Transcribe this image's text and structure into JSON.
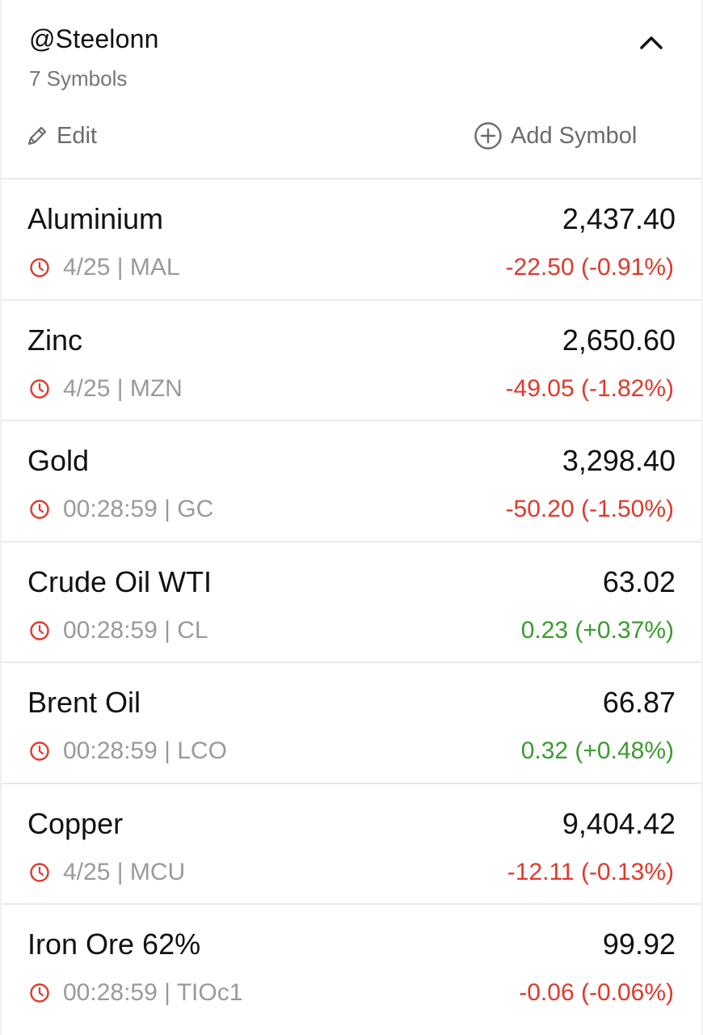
{
  "watchlist": {
    "title": "@Steelonn",
    "count_label": "7 Symbols",
    "edit_label": "Edit",
    "add_label": "Add Symbol",
    "collapse_icon": "chevron-up-icon",
    "edit_icon": "pencil-icon",
    "add_icon": "plus-circle-icon"
  },
  "colors": {
    "negative": "#e2382a",
    "positive": "#3a9c2e",
    "muted": "#9a9a9a",
    "clock": "#e2382a"
  },
  "rows": [
    {
      "name": "Aluminium",
      "price": "2,437.40",
      "time": "4/25",
      "code": "MAL",
      "change": "-22.50 (-0.91%)",
      "direction": "neg"
    },
    {
      "name": "Zinc",
      "price": "2,650.60",
      "time": "4/25",
      "code": "MZN",
      "change": "-49.05 (-1.82%)",
      "direction": "neg"
    },
    {
      "name": "Gold",
      "price": "3,298.40",
      "time": "00:28:59",
      "code": "GC",
      "change": "-50.20 (-1.50%)",
      "direction": "neg"
    },
    {
      "name": "Crude Oil WTI",
      "price": "63.02",
      "time": "00:28:59",
      "code": "CL",
      "change": "0.23 (+0.37%)",
      "direction": "pos"
    },
    {
      "name": "Brent Oil",
      "price": "66.87",
      "time": "00:28:59",
      "code": "LCO",
      "change": "0.32 (+0.48%)",
      "direction": "pos"
    },
    {
      "name": "Copper",
      "price": "9,404.42",
      "time": "4/25",
      "code": "MCU",
      "change": "-12.11 (-0.13%)",
      "direction": "neg"
    },
    {
      "name": "Iron Ore 62%",
      "price": "99.92",
      "time": "00:28:59",
      "code": "TIOc1",
      "change": "-0.06 (-0.06%)",
      "direction": "neg"
    }
  ]
}
